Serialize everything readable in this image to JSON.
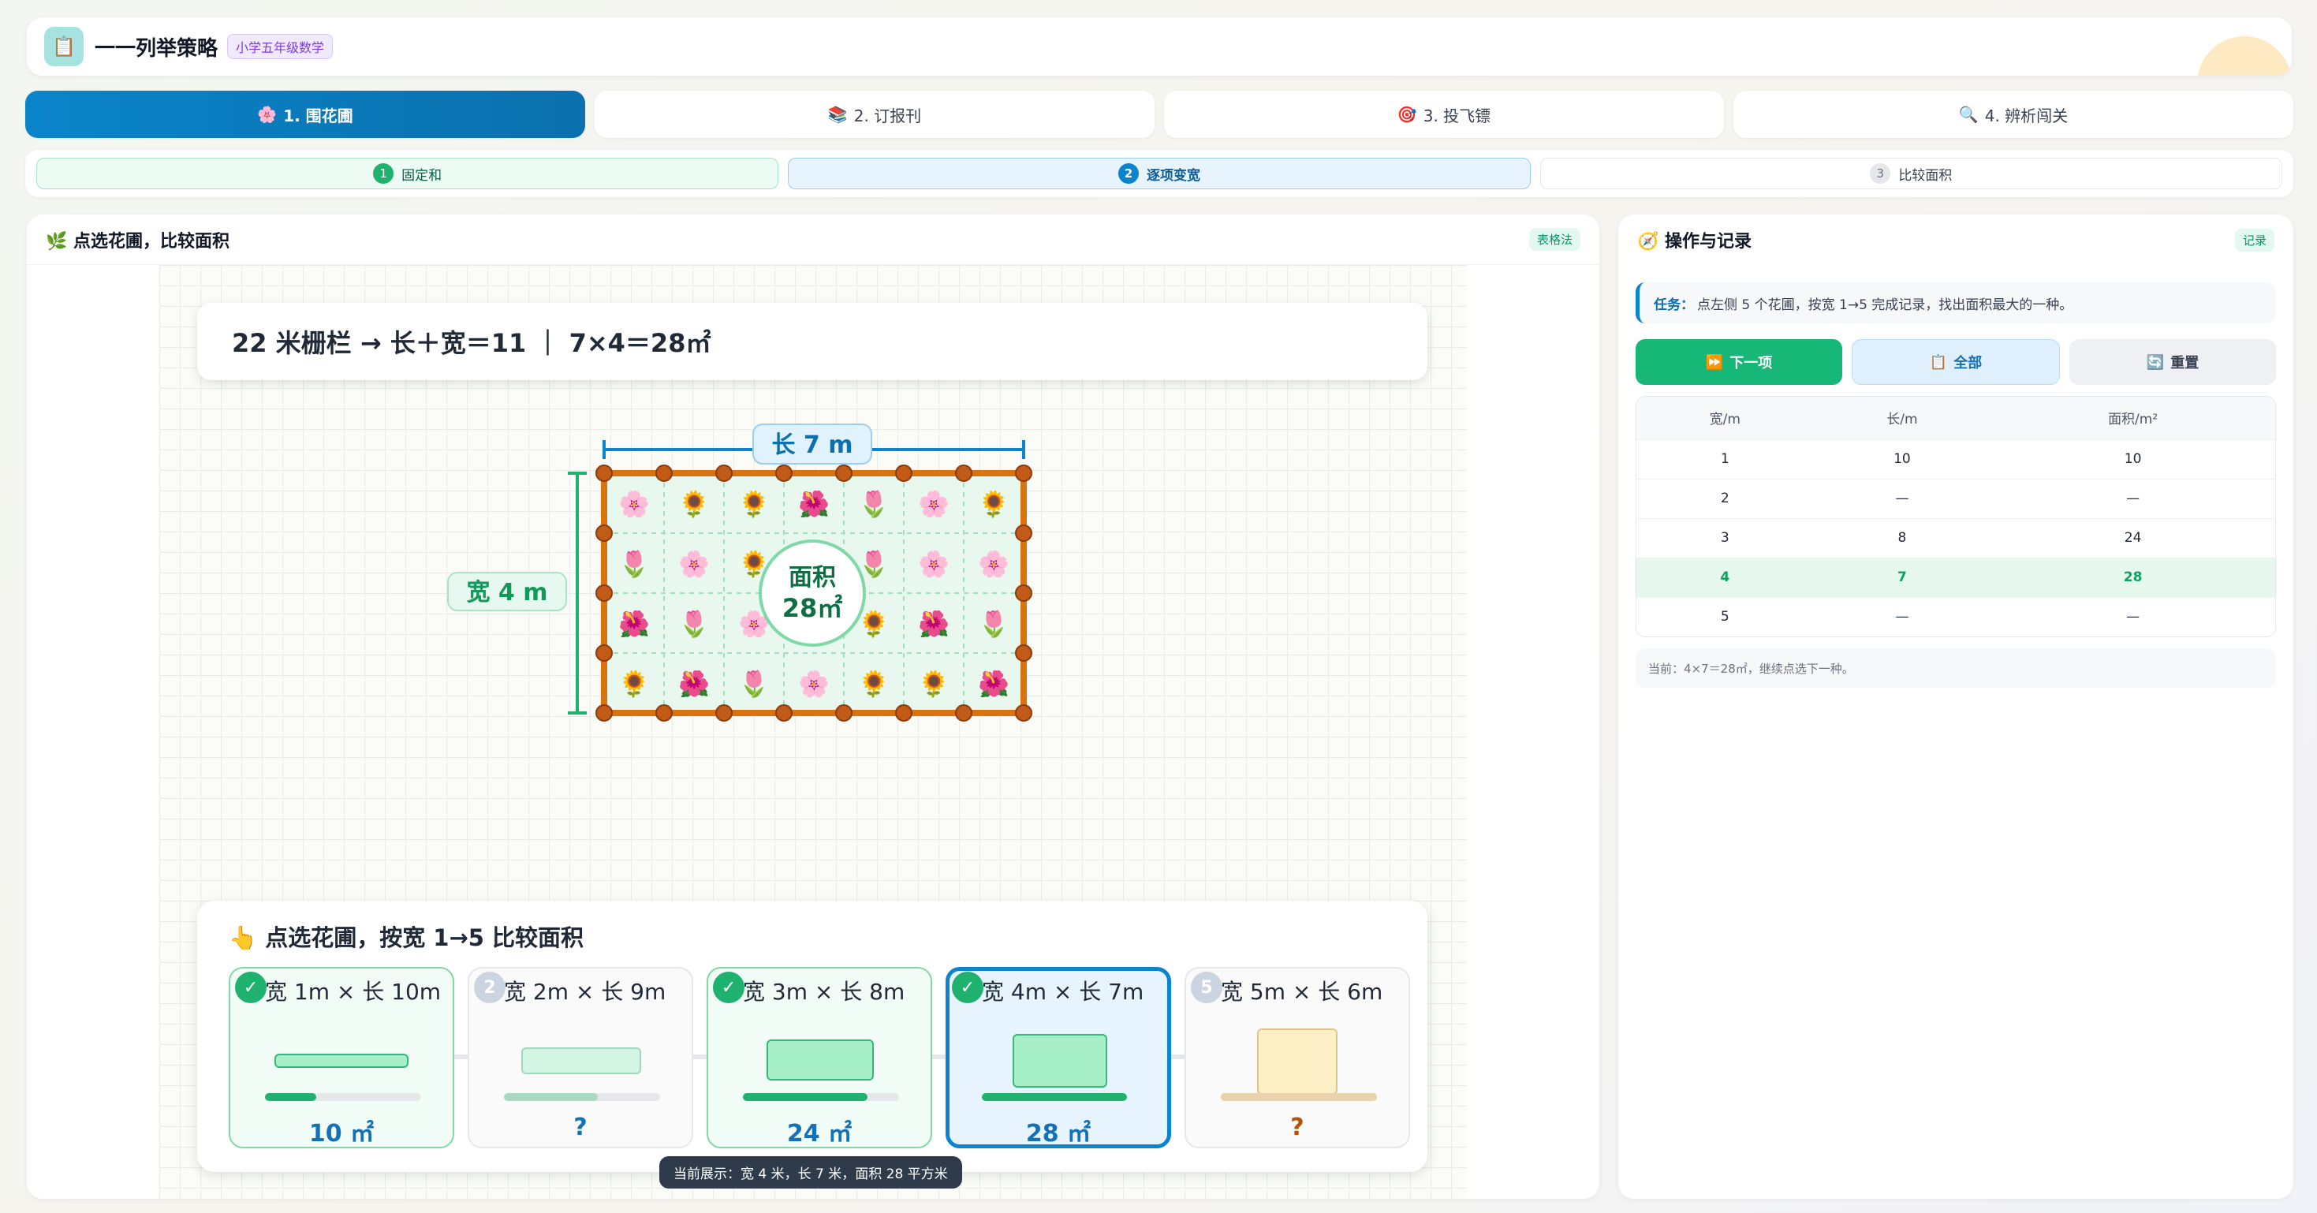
{
  "header": {
    "title": "一一列举策略",
    "grade_badge": "小学五年级数学",
    "logo_icon": "📋"
  },
  "main_tabs": [
    {
      "icon": "🌸",
      "label": "1. 围花圃",
      "active": true
    },
    {
      "icon": "📚",
      "label": "2. 订报刊",
      "active": false
    },
    {
      "icon": "🎯",
      "label": "3. 投飞镖",
      "active": false
    },
    {
      "icon": "🔍",
      "label": "4. 辨析闯关",
      "active": false
    }
  ],
  "steps": [
    {
      "num": "1",
      "label": "固定和",
      "state": "done"
    },
    {
      "num": "2",
      "label": "逐项变宽",
      "state": "current"
    },
    {
      "num": "3",
      "label": "比较面积",
      "state": "future"
    }
  ],
  "left_panel": {
    "title": "🌿 点选花圃，比较面积",
    "badge": "表格法",
    "formula": "22 米栅栏 → 长＋宽＝11 ｜ 7×4＝28㎡",
    "garden": {
      "length_label": "长 7 m",
      "width_label": "宽 4 m",
      "area_title": "面积",
      "area_value": "28㎡",
      "cols": 7,
      "rows": 4,
      "flowers": [
        "🌸",
        "🌻",
        "🌻",
        "🌺",
        "🌷",
        "🌸",
        "🌻",
        "🌷",
        "🌸",
        "🌻",
        "🌺",
        "🌷",
        "🌸",
        "🌸",
        "🌺",
        "🌷",
        "🌸",
        "🌻",
        "🌻",
        "🌺",
        "🌷",
        "🌻",
        "🌺",
        "🌷",
        "🌸",
        "🌻",
        "🌻",
        "🌺"
      ]
    },
    "selector": {
      "title": "👆 点选花圃，按宽 1→5 比较面积",
      "options": [
        {
          "num": "✓",
          "label": "宽 1m × 长 10m",
          "value": "10 ㎡",
          "state": "done",
          "progress": 0.33
        },
        {
          "num": "2",
          "label": "宽 2m × 长 9m",
          "value": "?",
          "state": "pending",
          "progress": 0.6
        },
        {
          "num": "✓",
          "label": "宽 3m × 长 8m",
          "value": "24 ㎡",
          "state": "done",
          "progress": 0.8
        },
        {
          "num": "✓",
          "label": "宽 4m × 长 7m",
          "value": "28 ㎡",
          "state": "selected",
          "progress": 0.93
        },
        {
          "num": "5",
          "label": "宽 5m × 长 6m",
          "value": "?",
          "state": "unknown",
          "progress": 1.0
        }
      ]
    },
    "status_text": "当前展示：宽 4 米，长 7 米，面积 28 平方米"
  },
  "right_panel": {
    "title": "🧭 操作与记录",
    "badge": "记录",
    "task_lead": "任务：",
    "task_text": "点左侧 5 个花圃，按宽 1→5 完成记录，找出面积最大的一种。",
    "buttons": [
      {
        "icon": "⏩",
        "label": "下一项"
      },
      {
        "icon": "📋",
        "label": "全部"
      },
      {
        "icon": "🔄",
        "label": "重置"
      }
    ],
    "table": {
      "headers": [
        "宽/m",
        "长/m",
        "面积/m²"
      ],
      "rows": [
        [
          "1",
          "10",
          "10"
        ],
        [
          "2",
          "—",
          "—"
        ],
        [
          "3",
          "8",
          "24"
        ],
        [
          "4",
          "7",
          "28"
        ],
        [
          "5",
          "—",
          "—"
        ]
      ],
      "highlight_row": 3
    },
    "current_note": "当前：4×7＝28㎡，继续点选下一种。"
  }
}
